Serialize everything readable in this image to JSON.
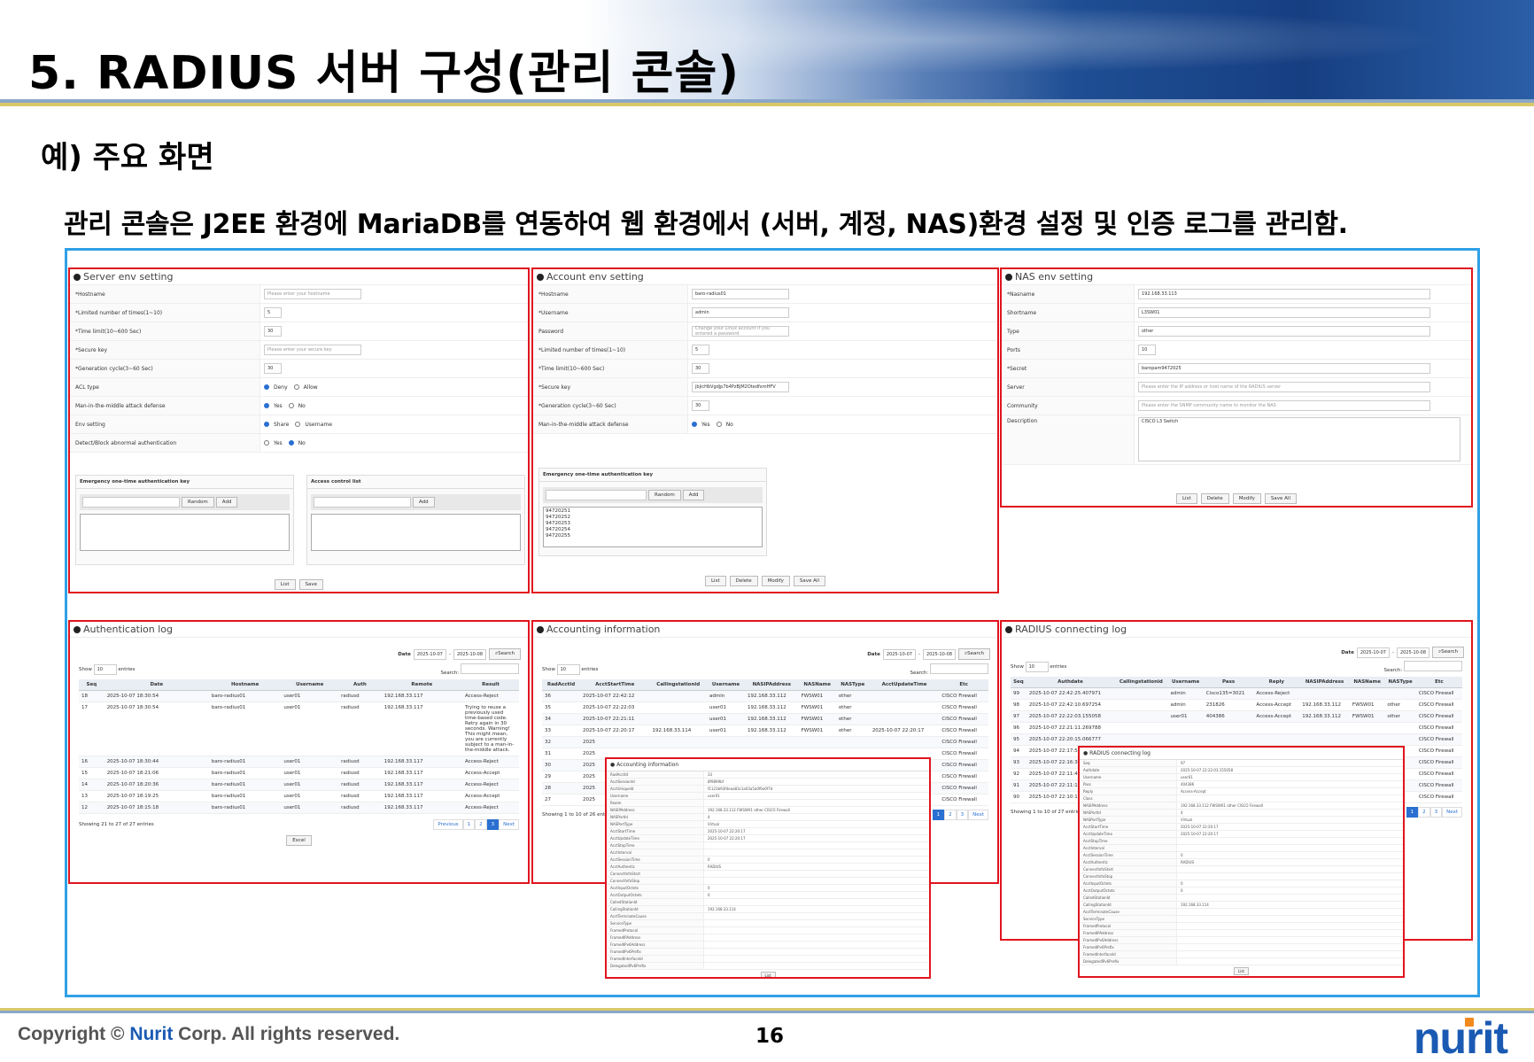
{
  "slide": {
    "title": "5. RADIUS 서버 구성(관리 콘솔)",
    "subtitle": "예) 주요 화면",
    "description": "관리 콘솔은 J2EE 환경에 MariaDB를 연동하여 웹 환경에서 (서버, 계정, NAS)환경 설정 및 인증 로그를 관리함.",
    "copyright_prefix": "Copyright © ",
    "copyright_brand": "Nurit",
    "copyright_suffix": " Corp. All rights reserved.",
    "page_number": "16",
    "logo_text": "nurit"
  },
  "server_env": {
    "title": "Server env setting",
    "fields": [
      {
        "label": "*Hostname",
        "value": "Please enter your hostname",
        "placeholder": true
      },
      {
        "label": "*Limited number of times(1~10)",
        "value": "5"
      },
      {
        "label": "*Time limit(10~600 Sec)",
        "value": "30"
      },
      {
        "label": "*Secure key",
        "value": "Please enter your secure key",
        "placeholder": true
      },
      {
        "label": "*Generation cycle(3~60 Sec)",
        "value": "30"
      }
    ],
    "acl": {
      "label": "ACL type",
      "opt1": "Deny",
      "opt2": "Allow"
    },
    "mitm": {
      "label": "Man-in-the-middle attack defense",
      "opt1": "Yes",
      "opt2": "No"
    },
    "env": {
      "label": "Env setting",
      "opt1": "Share",
      "opt2": "Username"
    },
    "detect": {
      "label": "Detect/Block abnormal authentication",
      "opt1": "Yes",
      "opt2": "No"
    },
    "otp_box": "Emergency one-time authentication key",
    "acl_box": "Access control list",
    "random": "Random",
    "add": "Add",
    "list": "List",
    "save": "Save"
  },
  "account_env": {
    "title": "Account env setting",
    "fields": [
      {
        "label": "*Hostname",
        "value": "baro-radius01"
      },
      {
        "label": "*Username",
        "value": "admin"
      },
      {
        "label": "Password",
        "value": "Change your Linux account if you entered a password",
        "placeholder": true
      },
      {
        "label": "*Limited number of times(1~10)",
        "value": "5"
      },
      {
        "label": "*Time limit(10~600 Sec)",
        "value": "30"
      },
      {
        "label": "*Secure key",
        "value": "jbjicHbVgdjp7b4PzBjM2OtedfxmHFV"
      },
      {
        "label": "*Generation cycle(3~60 Sec)",
        "value": "30"
      }
    ],
    "mitm": {
      "label": "Man-in-the-middle attack defense",
      "opt1": "Yes",
      "opt2": "No"
    },
    "otp_box": "Emergency one-time authentication key",
    "otp_keys": [
      "94720251",
      "94720252",
      "94720253",
      "94720254",
      "94720255"
    ],
    "random": "Random",
    "add": "Add",
    "buttons": [
      "List",
      "Delete",
      "Modify",
      "Save All"
    ]
  },
  "nas_env": {
    "title": "NAS env setting",
    "fields": [
      {
        "label": "*Nasname",
        "value": "192.168.33.113"
      },
      {
        "label": "Shortname",
        "value": "L3SW01"
      },
      {
        "label": "Type",
        "value": "other"
      },
      {
        "label": "Ports",
        "value": "10"
      },
      {
        "label": "*Secret",
        "value": "baropam9472025"
      },
      {
        "label": "Server",
        "value": "Please enter the IP address or host name of the RADIUS server",
        "placeholder": true
      },
      {
        "label": "Community",
        "value": "Please enter the SNMP community name to monitor the NAS",
        "placeholder": true
      }
    ],
    "description_label": "Description",
    "description_value": "CISCO L3 Switch",
    "buttons": [
      "List",
      "Delete",
      "Modify",
      "Save All"
    ]
  },
  "auth_log": {
    "title": "Authentication log",
    "date_label": "Date",
    "date_from": "2025-10-07",
    "date_to": "2025-10-08",
    "search_btn": "Search",
    "show": "Show",
    "entries_n": "10",
    "entries": "entries",
    "search_label": "Search:",
    "columns": [
      "Seq",
      "Date",
      "Hostname",
      "Username",
      "Auth",
      "Remote",
      "Result"
    ],
    "rows": [
      [
        "18",
        "2025-10-07 18:30:54",
        "baro-radius01",
        "user01",
        "radiusd",
        "192.168.33.117",
        "Access-Reject"
      ],
      [
        "17",
        "2025-10-07 18:30:54",
        "baro-radius01",
        "user01",
        "radiusd",
        "192.168.33.117",
        "Trying to reuse a previously used time-based code. Retry again in 30 seconds. Warning! This might mean, you are currently subject to a man-in-the-middle attack."
      ],
      [
        "16",
        "2025-10-07 18:30:44",
        "baro-radius01",
        "user01",
        "radiusd",
        "192.168.33.117",
        "Access-Reject"
      ],
      [
        "15",
        "2025-10-07 18:21:06",
        "baro-radius01",
        "user01",
        "radiusd",
        "192.168.33.117",
        "Access-Accept"
      ],
      [
        "14",
        "2025-10-07 18:20:36",
        "baro-radius01",
        "user01",
        "radiusd",
        "192.168.33.117",
        "Access-Reject"
      ],
      [
        "13",
        "2025-10-07 18:19:25",
        "baro-radius01",
        "user01",
        "radiusd",
        "192.168.33.117",
        "Access-Accept"
      ],
      [
        "12",
        "2025-10-07 18:15:18",
        "baro-radius01",
        "user01",
        "radiusd",
        "192.168.33.117",
        "Access-Reject"
      ]
    ],
    "showing": "Showing 21 to 27 of 27 entries",
    "pages": [
      "Previous",
      "1",
      "2",
      "3",
      "Next"
    ],
    "excel": "Excel"
  },
  "acct_info": {
    "title": "Accounting information",
    "date_label": "Date",
    "date_from": "2025-10-07",
    "date_to": "2025-10-08",
    "search_btn": "Search",
    "show": "Show",
    "entries_n": "10",
    "entries": "entries",
    "search_label": "Search:",
    "columns": [
      "RadAcctId",
      "AcctStartTime",
      "Callingstationid",
      "Username",
      "NASIPAddress",
      "NASName",
      "NASType",
      "AcctUpdateTime",
      "Etc"
    ],
    "rows": [
      [
        "36",
        "2025-10-07 22:42:12",
        "",
        "admin",
        "192.168.33.112",
        "FWSW01",
        "other",
        "",
        "CISCO Firewall"
      ],
      [
        "35",
        "2025-10-07 22:22:03",
        "",
        "user01",
        "192.168.33.112",
        "FWSW01",
        "other",
        "",
        "CISCO Firewall"
      ],
      [
        "34",
        "2025-10-07 22:21:11",
        "",
        "user01",
        "192.168.33.112",
        "FWSW01",
        "other",
        "",
        "CISCO Firewall"
      ],
      [
        "33",
        "2025-10-07 22:20:17",
        "192.168.33.114",
        "user01",
        "192.168.33.112",
        "FWSW01",
        "other",
        "2025-10-07 22:20:17",
        "CISCO Firewall"
      ],
      [
        "32",
        "2025",
        "",
        "",
        "",
        "",
        "",
        "",
        "CISCO Firewall"
      ],
      [
        "31",
        "2025",
        "",
        "",
        "",
        "",
        "",
        "",
        "CISCO Firewall"
      ],
      [
        "30",
        "2025",
        "",
        "",
        "",
        "",
        "",
        "",
        "CISCO Firewall"
      ],
      [
        "29",
        "2025",
        "",
        "",
        "",
        "",
        "",
        "",
        "CISCO Firewall"
      ],
      [
        "28",
        "2025",
        "",
        "",
        "",
        "",
        "",
        "",
        "CISCO Firewall"
      ],
      [
        "27",
        "2025",
        "",
        "",
        "",
        "",
        "",
        "",
        "CISCO Firewall"
      ]
    ],
    "showing": "Showing 1 to 10 of 26 entries",
    "pages": [
      "1",
      "2",
      "3",
      "Next"
    ],
    "popup_title": "Accounting information",
    "popup_rows": [
      "RadAcctId",
      "AcctSessionId",
      "AcctUniqueId",
      "Username",
      "Realm",
      "NASIPAddress",
      "NASPortId",
      "NASPortType",
      "AcctStartTime",
      "AcctUpdateTime",
      "AcctStopTime",
      "AcctInterval",
      "AcctSessionTime",
      "AcctAuthentic",
      "ConnectInfoStart",
      "ConnectInfoStop",
      "AcctInputOctets",
      "AcctOutputOctets",
      "CalledStationId",
      "CallingStationId",
      "AcctTerminateCause",
      "ServiceType",
      "FramedProtocol",
      "FramedIPAddress",
      "FramedIPv6Address",
      "FramedIPv6Prefix",
      "FramedInterfaceId",
      "DelegatedIPv6Prefix"
    ],
    "popup_values": [
      "33",
      "8f9899bf",
      "f1123b93fdeaa83c1a03a5a0f6e0f7d",
      "user01",
      "",
      "192.168.33.112 FWSW01 other CISCO Firewall",
      "4",
      "Virtual",
      "2025-10-07 22:20:17",
      "2025-10-07 22:20:17",
      "",
      "",
      "0",
      "RADIUS",
      "",
      "",
      "0",
      "0",
      "",
      "192.168.33.114"
    ],
    "popup_btn": "List"
  },
  "radius_log": {
    "title": "RADIUS connecting log",
    "date_label": "Date",
    "date_from": "2025-10-07",
    "date_to": "2025-10-08",
    "search_btn": "Search",
    "show": "Show",
    "entries_n": "10",
    "entries": "entries",
    "search_label": "Search:",
    "columns": [
      "Seq",
      "Authdate",
      "Callingstationid",
      "Username",
      "Pass",
      "Reply",
      "NASIPAddress",
      "NASName",
      "NASType",
      "Etc"
    ],
    "rows": [
      [
        "99",
        "2025-10-07 22:42:25.407971",
        "",
        "admin",
        "Cisco135=3021",
        "Access-Reject",
        "",
        "",
        "",
        "CISCO Firewall"
      ],
      [
        "98",
        "2025-10-07 22:42:10.697254",
        "",
        "admin",
        "231826",
        "Access-Accept",
        "192.168.33.112",
        "FWSW01",
        "other",
        "CISCO Firewall"
      ],
      [
        "97",
        "2025-10-07 22:22:03.155058",
        "",
        "user01",
        "404386",
        "Access-Accept",
        "192.168.33.112",
        "FWSW01",
        "other",
        "CISCO Firewall"
      ],
      [
        "96",
        "2025-10-07 22:21:11.269788",
        "",
        "",
        "",
        "",
        "",
        "",
        "",
        "CISCO Firewall"
      ],
      [
        "95",
        "2025-10-07 22:20:15.066777",
        "",
        "",
        "",
        "",
        "",
        "",
        "",
        "CISCO Firewall"
      ],
      [
        "94",
        "2025-10-07 22:17:51.314062",
        "",
        "",
        "",
        "",
        "",
        "",
        "",
        "CISCO Firewall"
      ],
      [
        "93",
        "2025-10-07 22:16:34.007177",
        "",
        "",
        "",
        "",
        "",
        "",
        "",
        "CISCO Firewall"
      ],
      [
        "92",
        "2025-10-07 22:11:47.671050",
        "",
        "",
        "",
        "",
        "",
        "",
        "",
        "CISCO Firewall"
      ],
      [
        "91",
        "2025-10-07 22:11:16.490300",
        "",
        "",
        "",
        "",
        "",
        "",
        "",
        "CISCO Firewall"
      ],
      [
        "90",
        "2025-10-07 22:10:11.227355",
        "",
        "",
        "",
        "",
        "",
        "",
        "",
        "CISCO Firewall"
      ]
    ],
    "showing": "Showing 1 to 10 of 27 entries",
    "pages": [
      "1",
      "2",
      "3",
      "Next"
    ],
    "popup_title": "RADIUS connecting log",
    "popup_rows": [
      "Seq",
      "Authdate",
      "Username",
      "Pass",
      "Reply",
      "Class",
      "NASIPAddress",
      "NASPortId",
      "NASPortType",
      "AcctStartTime",
      "AcctUpdateTime",
      "AcctStopTime",
      "AcctInterval",
      "AcctSessionTime",
      "AcctAuthentic",
      "ConnectInfoStart",
      "ConnectInfoStop",
      "AcctInputOctets",
      "AcctOutputOctets",
      "CalledStationId",
      "CallingStationId",
      "AcctTerminateCause",
      "ServiceType",
      "FramedProtocol",
      "FramedIPAddress",
      "FramedIPv6Address",
      "FramedIPv6Prefix",
      "FramedInterfaceId",
      "DelegatedIPv6Prefix"
    ],
    "popup_values": [
      "97",
      "2025-10-07 22:22:03.155058",
      "user01",
      "404386",
      "Access-Accept",
      "",
      "192.168.33.112 FWSW01 other CISCO Firewall",
      "4",
      "Virtual",
      "2025-10-07 22:20:17",
      "2025-10-07 22:20:17",
      "",
      "",
      "0",
      "RADIUS",
      "",
      "",
      "0",
      "0",
      "",
      "192.168.33.114"
    ],
    "popup_btn": "List"
  }
}
